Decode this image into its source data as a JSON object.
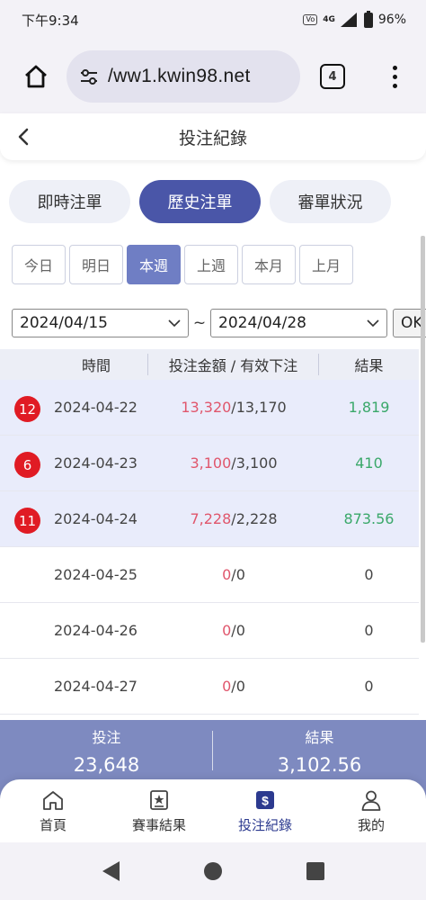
{
  "status": {
    "time": "下午9:34",
    "network": "4G",
    "battery": "96%"
  },
  "browser": {
    "url": "/ww1.kwin98.net",
    "tab_count": "4"
  },
  "page": {
    "title": "投注紀錄"
  },
  "tabs": [
    {
      "label": "即時注單",
      "active": false
    },
    {
      "label": "歷史注單",
      "active": true
    },
    {
      "label": "審單狀況",
      "active": false
    }
  ],
  "periods": [
    {
      "label": "今日",
      "active": false
    },
    {
      "label": "明日",
      "active": false
    },
    {
      "label": "本週",
      "active": true
    },
    {
      "label": "上週",
      "active": false
    },
    {
      "label": "本月",
      "active": false
    },
    {
      "label": "上月",
      "active": false
    }
  ],
  "daterange": {
    "from": "2024/04/15",
    "sep": "~",
    "to": "2024/04/28",
    "ok": "OK"
  },
  "table": {
    "headers": {
      "time": "時間",
      "bet": "投注金額 / 有效下注",
      "result": "結果"
    },
    "rows": [
      {
        "badge": "12",
        "date": "2024-04-22",
        "amount": "13,320",
        "valid": "/13,170",
        "result": "1,819"
      },
      {
        "badge": "6",
        "date": "2024-04-23",
        "amount": "3,100",
        "valid": "/3,100",
        "result": "410"
      },
      {
        "badge": "11",
        "date": "2024-04-24",
        "amount": "7,228",
        "valid": "/2,228",
        "result": "873.56"
      },
      {
        "badge": "",
        "date": "2024-04-25",
        "amount": "0",
        "valid": "/0",
        "result": "0"
      },
      {
        "badge": "",
        "date": "2024-04-26",
        "amount": "0",
        "valid": "/0",
        "result": "0"
      },
      {
        "badge": "",
        "date": "2024-04-27",
        "amount": "0",
        "valid": "/0",
        "result": "0"
      }
    ]
  },
  "summary": {
    "bet_label": "投注",
    "bet_value": "23,648",
    "result_label": "結果",
    "result_value": "3,102.56"
  },
  "nav": [
    {
      "label": "首頁",
      "icon": "home-icon"
    },
    {
      "label": "賽事結果",
      "icon": "star-badge-icon"
    },
    {
      "label": "投注紀錄",
      "icon": "dollar-icon"
    },
    {
      "label": "我的",
      "icon": "user-icon"
    }
  ],
  "colors": {
    "accent": "#4a56a8",
    "period_active": "#6f7ec4",
    "bet_amount": "#e0566c",
    "positive": "#3aa86a",
    "badge": "#e01b24",
    "summary_bg": "#7e8ac0"
  }
}
